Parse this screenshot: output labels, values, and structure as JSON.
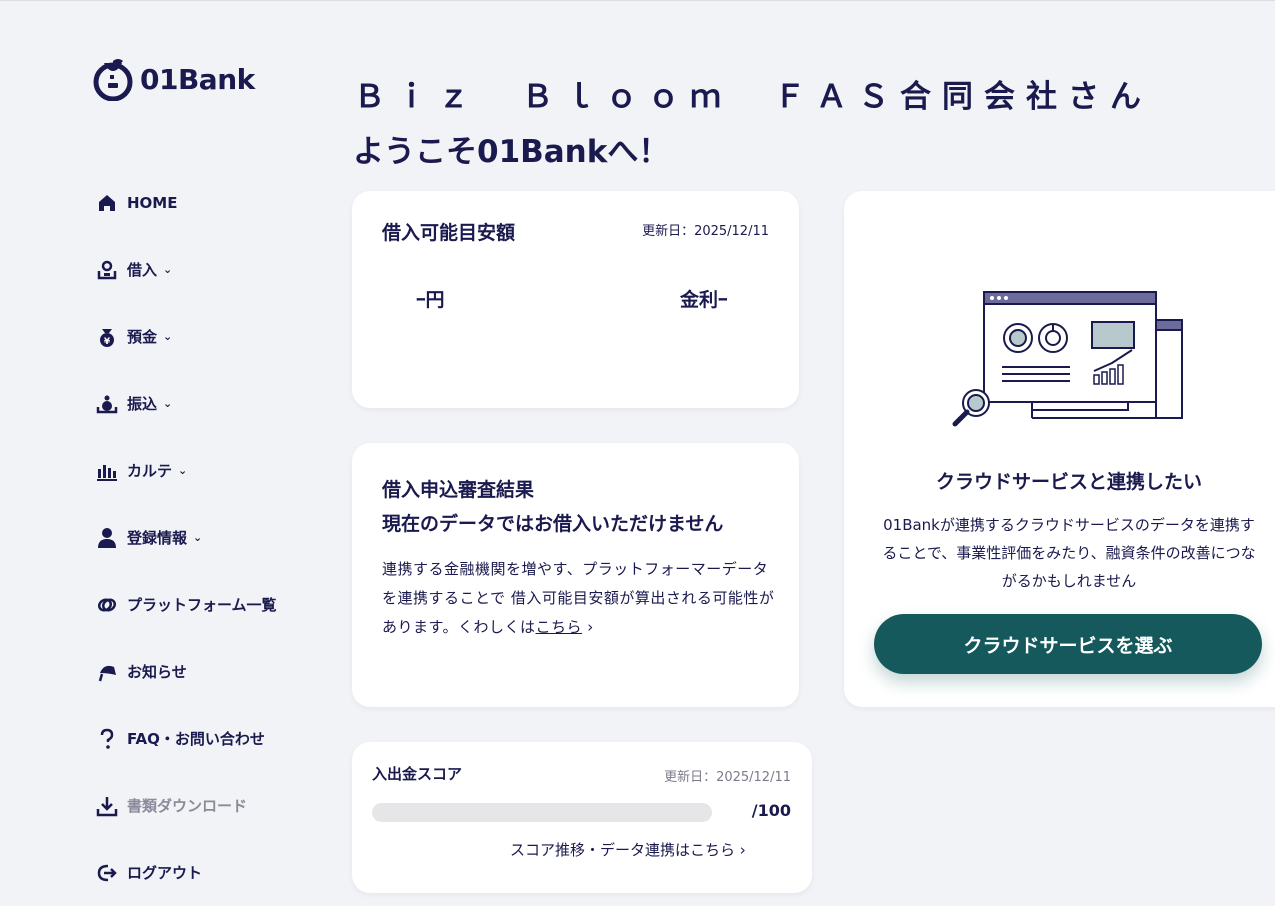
{
  "brand": {
    "name": "01Bank"
  },
  "sidebar": {
    "items": [
      {
        "label": "HOME",
        "icon": "home-icon"
      },
      {
        "label": "借入",
        "icon": "borrow-icon",
        "chevron": true
      },
      {
        "label": "預金",
        "icon": "deposit-icon",
        "chevron": true
      },
      {
        "label": "振込",
        "icon": "transfer-icon",
        "chevron": true
      },
      {
        "label": "カルテ",
        "icon": "chart-icon",
        "chevron": true
      },
      {
        "label": "登録情報",
        "icon": "user-icon",
        "chevron": true
      },
      {
        "label": "プラットフォーム一覧",
        "icon": "link-icon"
      },
      {
        "label": "お知らせ",
        "icon": "megaphone-icon"
      },
      {
        "label": "FAQ・お問い合わせ",
        "icon": "question-icon"
      },
      {
        "label": "書類ダウンロード",
        "icon": "download-icon"
      },
      {
        "label": "ログアウト",
        "icon": "logout-icon"
      }
    ]
  },
  "header": {
    "company": "Ｂｉｚ　Ｂｌｏｏｍ　ＦＡＳ合同会社さん",
    "welcome": "ようこそ01Bankへ！"
  },
  "borrow_card": {
    "title": "借入可能目安額",
    "updated": "更新日：2025/12/11",
    "amount": "ｰ円",
    "rate": "金利ｰ"
  },
  "review_card": {
    "title": "借入申込審査結果",
    "status": "現在のデータではお借入いただけません",
    "body": "連携する金融機関を増やす、プラットフォーマーデータを連携することで 借入可能目安額が算出される可能性があります。くわしくは",
    "link": "こちら"
  },
  "score_card": {
    "title": "入出金スコア",
    "updated": "更新日：2025/12/11",
    "score_fraction": 0,
    "max": "/100",
    "more": "スコア推移・データ連携はこちら"
  },
  "cloud_card": {
    "title": "クラウドサービスと連携したい",
    "description": "01Bankが連携するクラウドサービスのデータを連携することで、事業性評価をみたり、融資条件の改善につながるかもしれません",
    "button": "クラウドサービスを選ぶ"
  },
  "colors": {
    "navy": "#1a1a4e",
    "teal": "#15595c",
    "background": "#f2f3f7"
  }
}
